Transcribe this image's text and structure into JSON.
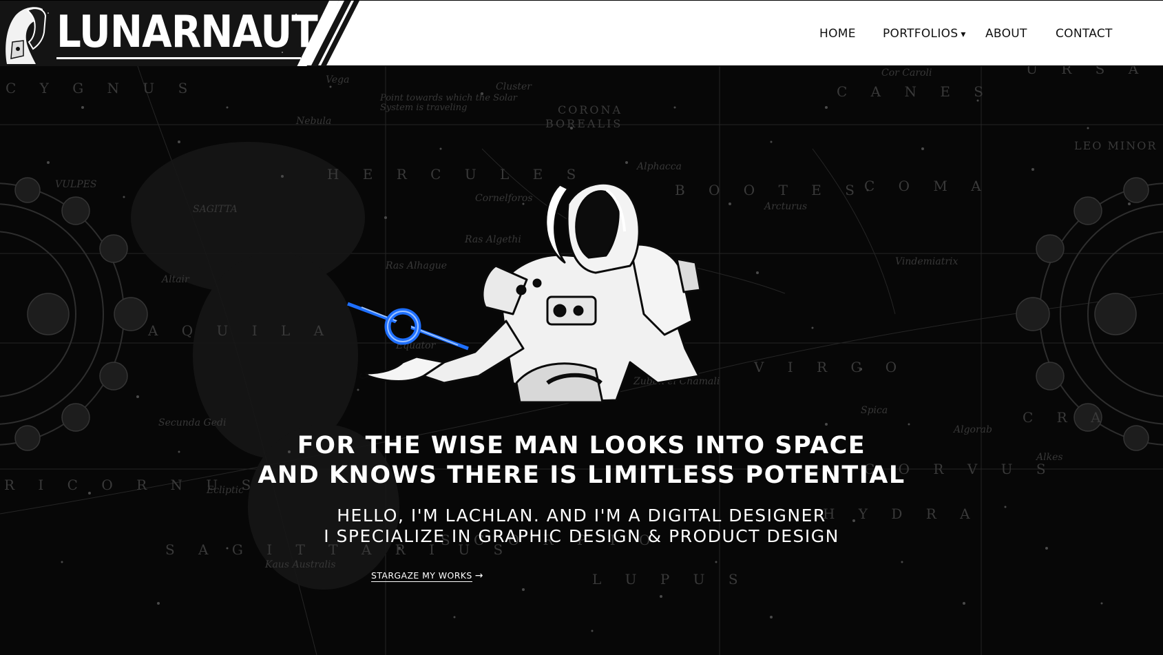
{
  "brand": {
    "name": "LUNARNAUT"
  },
  "nav": {
    "items": [
      {
        "label": "HOME"
      },
      {
        "label": "PORTFOLIOS",
        "caret": "▾"
      },
      {
        "label": "ABOUT"
      },
      {
        "label": "CONTACT"
      }
    ]
  },
  "hero": {
    "tagline": [
      "FOR THE WISE MAN LOOKS INTO SPACE",
      "AND KNOWS THERE IS LIMITLESS POTENTIAL"
    ],
    "intro": [
      "HELLO, I'M LACHLAN. AND I'M A DIGITAL DESIGNER",
      "I SPECIALIZE IN GRAPHIC DESIGN & PRODUCT DESIGN"
    ],
    "cta": {
      "label": "STARGAZE MY WORKS",
      "arrow": "→"
    }
  },
  "background": {
    "constellations": [
      "C Y G N U S",
      "H E R C U L E S",
      "B O O T E S",
      "C O M A",
      "C A N E S",
      "CORONA",
      "BOREALIS",
      "A Q U I L A",
      "V I R G O",
      "C O R V U S",
      "H Y D R A",
      "S A G I T T A R I U S",
      "L U P U S",
      "R I C O R N U S",
      "S C O R P I O",
      "U R S A",
      "LEO MINOR",
      "C R A"
    ],
    "stars": [
      "Vega",
      "Cluster",
      "Nebula",
      "Alphacca",
      "Arcturus",
      "Cor Caroli",
      "Cornelforos",
      "Ras Algethi",
      "Ras Alhague",
      "Equator",
      "Vindemiatrix",
      "Spica",
      "Ecliptic",
      "Algorab",
      "Alkes",
      "Secunda Gedi",
      "Zuben el Chamali",
      "Kaus Australis",
      "VULPES",
      "SAGITTA",
      "Altair",
      "Point towards which the Solar System is traveling"
    ]
  },
  "colors": {
    "accent_blue": "#1e6fff",
    "hero_bg": "#070707",
    "header_bg": "#ffffff",
    "logo_bg": "#141414"
  },
  "icons": [
    "astronaut-illustration",
    "black-hole-icon",
    "arrow-right-icon",
    "chevron-down-icon"
  ]
}
